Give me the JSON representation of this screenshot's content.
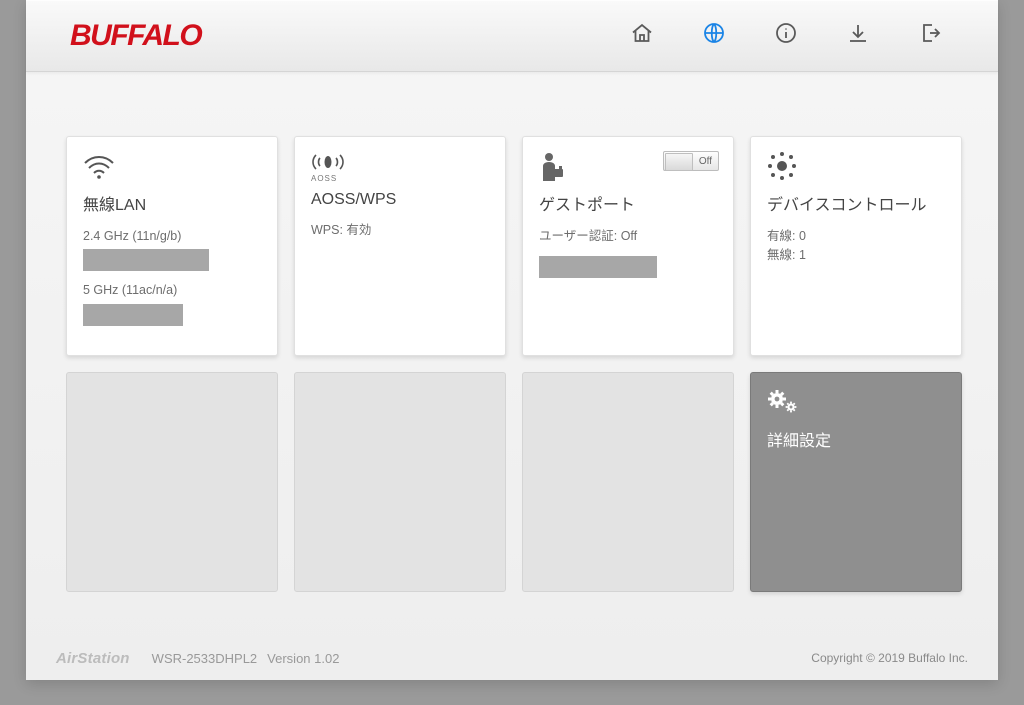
{
  "header": {
    "brand": "BUFFALO",
    "nav": [
      {
        "name": "home-icon"
      },
      {
        "name": "globe-icon",
        "active": true
      },
      {
        "name": "info-icon"
      },
      {
        "name": "download-icon"
      },
      {
        "name": "logout-icon"
      }
    ]
  },
  "cards": {
    "wlan": {
      "title": "無線LAN",
      "line1": "2.4 GHz (11n/g/b)",
      "line2": "5 GHz (11ac/n/a)"
    },
    "aoss": {
      "title": "AOSS/WPS",
      "sub_label": "AOSS",
      "line1": "WPS: 有効"
    },
    "guest": {
      "title": "ゲストポート",
      "toggle_label": "Off",
      "line1": "ユーザー認証: Off"
    },
    "device": {
      "title": "デバイスコントロール",
      "line1": "有線: 0",
      "line2": "無線: 1"
    },
    "advanced": {
      "title": "詳細設定"
    }
  },
  "footer": {
    "product_line": "AirStation",
    "model": "WSR-2533DHPL2",
    "version_label": "Version 1.02",
    "copyright": "Copyright © 2019 Buffalo Inc."
  }
}
